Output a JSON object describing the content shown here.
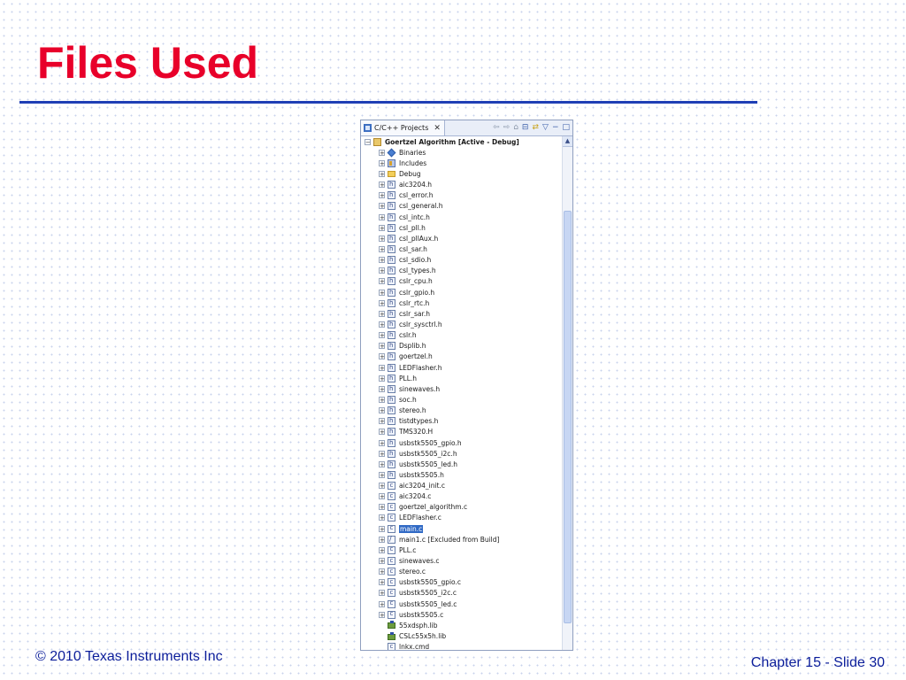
{
  "slide": {
    "title": "Files Used",
    "footer_left": "© 2010 Texas Instruments Inc",
    "footer_right": "Chapter 15 - Slide 30"
  },
  "panel": {
    "tab_label": "C/C++ Projects",
    "close_glyph": "✕",
    "toolbar_icons": [
      "back-icon",
      "forward-icon",
      "home-icon",
      "collapse-all-icon",
      "link-editor-icon",
      "view-menu-icon",
      "minimize-icon",
      "maximize-icon"
    ],
    "scroll_up_glyph": "▲",
    "tree": [
      {
        "label": "Goertzel Algorithm  [Active - Debug]",
        "icon": "project",
        "expander": "−",
        "indent": 0,
        "bold": true
      },
      {
        "label": "Binaries",
        "icon": "diamond",
        "expander": "+",
        "indent": 1
      },
      {
        "label": "Includes",
        "icon": "includes",
        "expander": "+",
        "indent": 1
      },
      {
        "label": "Debug",
        "icon": "folder",
        "expander": "+",
        "indent": 1
      },
      {
        "label": "aic3204.h",
        "icon": "h",
        "expander": "+",
        "indent": 1
      },
      {
        "label": "csl_error.h",
        "icon": "h",
        "expander": "+",
        "indent": 1
      },
      {
        "label": "csl_general.h",
        "icon": "h",
        "expander": "+",
        "indent": 1
      },
      {
        "label": "csl_intc.h",
        "icon": "h",
        "expander": "+",
        "indent": 1
      },
      {
        "label": "csl_pll.h",
        "icon": "h",
        "expander": "+",
        "indent": 1
      },
      {
        "label": "csl_pllAux.h",
        "icon": "h",
        "expander": "+",
        "indent": 1
      },
      {
        "label": "csl_sar.h",
        "icon": "h",
        "expander": "+",
        "indent": 1
      },
      {
        "label": "csl_sdio.h",
        "icon": "h",
        "expander": "+",
        "indent": 1
      },
      {
        "label": "csl_types.h",
        "icon": "h",
        "expander": "+",
        "indent": 1
      },
      {
        "label": "cslr_cpu.h",
        "icon": "h",
        "expander": "+",
        "indent": 1
      },
      {
        "label": "cslr_gpio.h",
        "icon": "h",
        "expander": "+",
        "indent": 1
      },
      {
        "label": "cslr_rtc.h",
        "icon": "h",
        "expander": "+",
        "indent": 1
      },
      {
        "label": "cslr_sar.h",
        "icon": "h",
        "expander": "+",
        "indent": 1
      },
      {
        "label": "cslr_sysctrl.h",
        "icon": "h",
        "expander": "+",
        "indent": 1
      },
      {
        "label": "cslr.h",
        "icon": "h",
        "expander": "+",
        "indent": 1
      },
      {
        "label": "Dsplib.h",
        "icon": "h",
        "expander": "+",
        "indent": 1
      },
      {
        "label": "goertzel.h",
        "icon": "h",
        "expander": "+",
        "indent": 1
      },
      {
        "label": "LEDFlasher.h",
        "icon": "h",
        "expander": "+",
        "indent": 1
      },
      {
        "label": "PLL.h",
        "icon": "h",
        "expander": "+",
        "indent": 1
      },
      {
        "label": "sinewaves.h",
        "icon": "h",
        "expander": "+",
        "indent": 1
      },
      {
        "label": "soc.h",
        "icon": "h",
        "expander": "+",
        "indent": 1
      },
      {
        "label": "stereo.h",
        "icon": "h",
        "expander": "+",
        "indent": 1
      },
      {
        "label": "tistdtypes.h",
        "icon": "h",
        "expander": "+",
        "indent": 1
      },
      {
        "label": "TMS320.H",
        "icon": "h",
        "expander": "+",
        "indent": 1
      },
      {
        "label": "usbstk5505_gpio.h",
        "icon": "h",
        "expander": "+",
        "indent": 1
      },
      {
        "label": "usbstk5505_i2c.h",
        "icon": "h",
        "expander": "+",
        "indent": 1
      },
      {
        "label": "usbstk5505_led.h",
        "icon": "h",
        "expander": "+",
        "indent": 1
      },
      {
        "label": "usbstk5505.h",
        "icon": "h",
        "expander": "+",
        "indent": 1
      },
      {
        "label": "aic3204_init.c",
        "icon": "c",
        "expander": "+",
        "indent": 1
      },
      {
        "label": "aic3204.c",
        "icon": "c",
        "expander": "+",
        "indent": 1
      },
      {
        "label": "goertzel_algorithm.c",
        "icon": "c",
        "expander": "+",
        "indent": 1
      },
      {
        "label": "LEDFlasher.c",
        "icon": "c",
        "expander": "+",
        "indent": 1
      },
      {
        "label": "main.c",
        "icon": "c",
        "expander": "+",
        "indent": 1,
        "selected": true
      },
      {
        "label": "main1.c  [Excluded from Build]",
        "icon": "cx",
        "expander": "+",
        "indent": 1
      },
      {
        "label": "PLL.c",
        "icon": "c",
        "expander": "+",
        "indent": 1
      },
      {
        "label": "sinewaves.c",
        "icon": "c",
        "expander": "+",
        "indent": 1
      },
      {
        "label": "stereo.c",
        "icon": "c",
        "expander": "+",
        "indent": 1
      },
      {
        "label": "usbstk5505_gpio.c",
        "icon": "c",
        "expander": "+",
        "indent": 1
      },
      {
        "label": "usbstk5505_i2c.c",
        "icon": "c",
        "expander": "+",
        "indent": 1
      },
      {
        "label": "usbstk5505_led.c",
        "icon": "c",
        "expander": "+",
        "indent": 1
      },
      {
        "label": "usbstk5505.c",
        "icon": "c",
        "expander": "+",
        "indent": 1
      },
      {
        "label": "55xdsph.lib",
        "icon": "lib",
        "expander": "",
        "indent": 1
      },
      {
        "label": "CSLc55x5h.lib",
        "icon": "lib",
        "expander": "",
        "indent": 1
      },
      {
        "label": "lnkx.cmd",
        "icon": "cmd",
        "expander": "",
        "indent": 1
      }
    ]
  },
  "colors": {
    "title": "#e8002a",
    "rule": "#1f3fb5",
    "footer": "#0b1d9a",
    "selection": "#316ac5"
  }
}
